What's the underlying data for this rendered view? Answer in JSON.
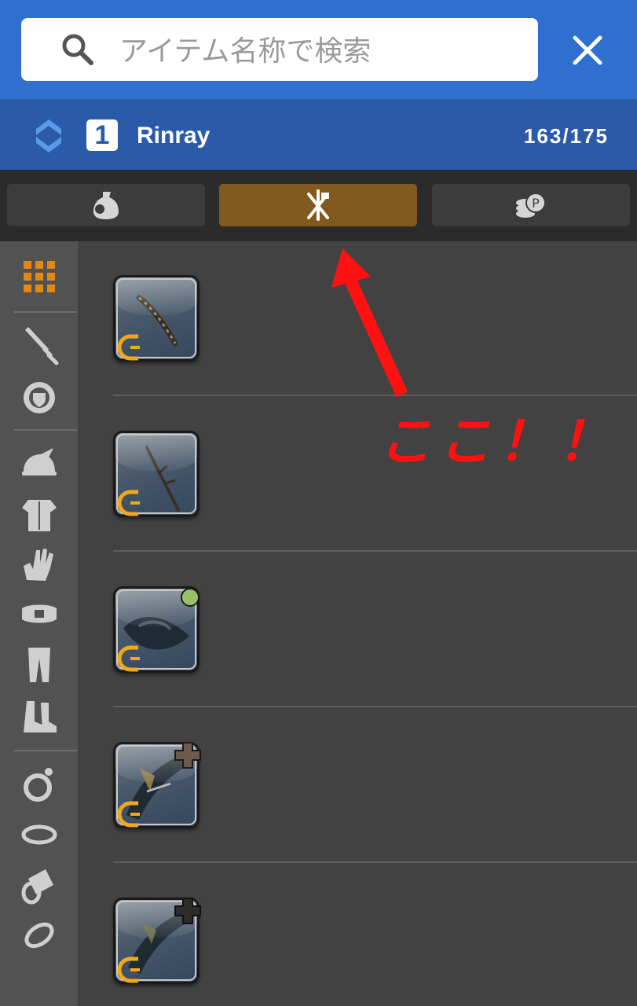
{
  "search": {
    "placeholder": "アイテム名称で検索",
    "search_icon": "search-icon",
    "close_icon": "close-icon"
  },
  "character": {
    "number": "1",
    "name": "Rinray",
    "inventory_count": "163/175"
  },
  "tabs": [
    {
      "icon": "item-bag-icon",
      "active": false
    },
    {
      "icon": "weapon-armor-icon",
      "active": true
    },
    {
      "icon": "currency-icon",
      "active": false
    }
  ],
  "sidebar": {
    "items": [
      {
        "icon": "grid-all-icon",
        "active": true
      },
      {
        "icon": "sword-icon"
      },
      {
        "icon": "shield-icon"
      },
      {
        "icon": "head-icon"
      },
      {
        "icon": "body-icon"
      },
      {
        "icon": "hands-icon"
      },
      {
        "icon": "waist-icon"
      },
      {
        "icon": "legs-icon"
      },
      {
        "icon": "feet-icon"
      },
      {
        "icon": "earrings-icon"
      },
      {
        "icon": "necklace-icon"
      },
      {
        "icon": "bracelet-icon"
      },
      {
        "icon": "ring-icon"
      }
    ]
  },
  "items": [
    {
      "name": "item-1",
      "badge": null
    },
    {
      "name": "item-2",
      "badge": null
    },
    {
      "name": "item-3",
      "badge": "green-dot"
    },
    {
      "name": "item-4",
      "badge": "brown-cross"
    },
    {
      "name": "item-5",
      "badge": "black-cross"
    }
  ],
  "colors": {
    "header_blue": "#2f6fd0",
    "char_bar_blue": "#2a5aa8",
    "active_tab": "#82591e",
    "annotation_red": "#ff1111",
    "grid_orange": "#e08a12"
  },
  "annotation": {
    "text": "ここ！！"
  }
}
